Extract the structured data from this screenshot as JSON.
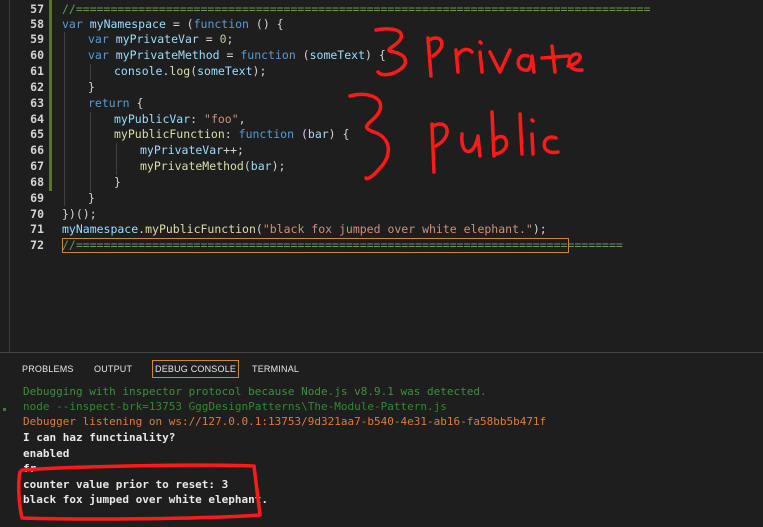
{
  "editor": {
    "line_numbers": [
      "57",
      "58",
      "59",
      "60",
      "61",
      "62",
      "63",
      "64",
      "65",
      "66",
      "67",
      "68",
      "69",
      "70",
      "71",
      "72"
    ],
    "code": {
      "l57": "//===================================================================================",
      "l58": [
        "var",
        " ",
        "myNamespace",
        " = (",
        "function",
        " () {"
      ],
      "l59": [
        "var",
        " ",
        "myPrivateVar",
        " = ",
        "0",
        ";"
      ],
      "l60": [
        "var",
        " ",
        "myPrivateMethod",
        " = ",
        "function",
        " (",
        "someText",
        ") {"
      ],
      "l61": [
        "console",
        ".",
        "log",
        "(",
        "someText",
        ");"
      ],
      "l62": "}",
      "l63": [
        "return",
        " {"
      ],
      "l64": [
        "myPublicVar",
        ": ",
        "\"foo\"",
        ","
      ],
      "l65": [
        "myPublicFunction",
        ": ",
        "function",
        " (",
        "bar",
        ") {"
      ],
      "l66": [
        "myPrivateVar",
        "++;"
      ],
      "l67": [
        "myPrivateMethod",
        "(",
        "bar",
        ");"
      ],
      "l68": "}",
      "l69": "}",
      "l70": "})();",
      "l71": [
        "myNamespace",
        ".",
        "myPublicFunction",
        "(",
        "\"black fox jumped over white elephant.\"",
        ");"
      ],
      "l72": "//==============================================================================="
    }
  },
  "annotations": {
    "private_label": "private",
    "public_label": "public"
  },
  "panel": {
    "tabs": [
      {
        "label": "PROBLEMS",
        "active": false
      },
      {
        "label": "OUTPUT",
        "active": false
      },
      {
        "label": "DEBUG CONSOLE",
        "active": true
      },
      {
        "label": "TERMINAL",
        "active": false
      }
    ],
    "console_lines": [
      "Debugging with inspector protocol because Node.js v8.9.1 was detected.",
      "node --inspect-brk=13753 GggDesignPatterns\\The-Module-Pattern.js",
      "Debugger listening on ws://127.0.0.1:13753/9d321aa7-b540-4e31-ab16-fa58bb5b471f",
      "I can haz functinality?",
      "enabled",
      "fr",
      "counter value prior to reset: 3",
      "black fox jumped over white elephant."
    ]
  },
  "colors": {
    "keyword": "#569cd6",
    "variable": "#9cdcfe",
    "function": "#dcdcaa",
    "string": "#ce9178",
    "number": "#b5cea8",
    "comment": "#6a9955",
    "annotation_red": "#ff1a1a",
    "active_tab_border": "#c98a3c"
  }
}
